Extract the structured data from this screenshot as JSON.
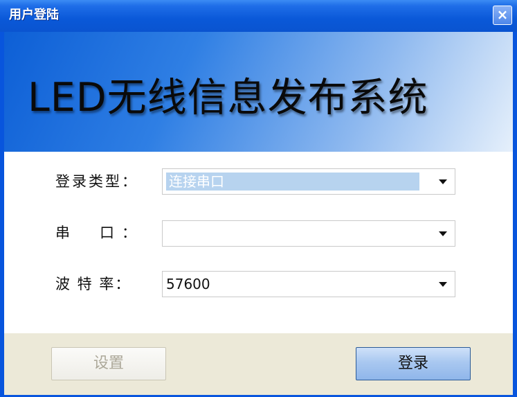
{
  "window": {
    "title": "用户登陆",
    "close_symbol": "×"
  },
  "banner": {
    "text": "LED无线信息发布系统"
  },
  "form": {
    "login_type": {
      "label": "登录类型：",
      "value": "连接串口"
    },
    "serial_port": {
      "label": "串　口：",
      "value": ""
    },
    "baud_rate": {
      "label": "波 特 率：",
      "value": "57600"
    }
  },
  "buttons": {
    "settings_label": "设置",
    "login_label": "登录"
  },
  "colors": {
    "titlebar": "#0a58d8",
    "selected_highlight": "#b7d3ef",
    "bottom_bar": "#ece9d8"
  },
  "icons": [
    "close-icon",
    "dropdown-arrow-icon"
  ]
}
